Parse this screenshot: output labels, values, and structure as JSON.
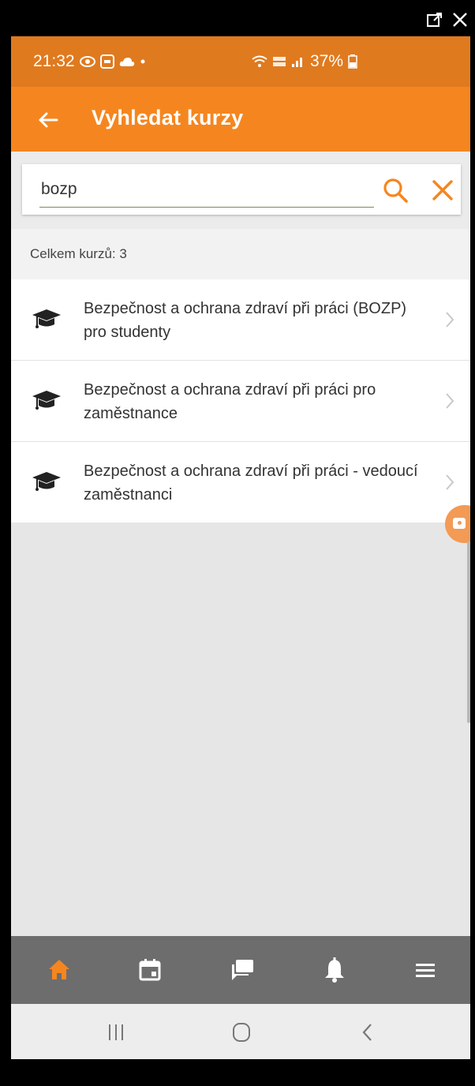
{
  "status": {
    "time": "21:32",
    "battery": "37%"
  },
  "appbar": {
    "title": "Vyhledat kurzy"
  },
  "search": {
    "value": "bozp"
  },
  "results": {
    "count_label": "Celkem kurzů: 3",
    "items": [
      {
        "title": "Bezpečnost a ochrana zdraví při práci (BOZP) pro studenty"
      },
      {
        "title": "Bezpečnost a ochrana zdraví při práci pro zaměstnance"
      },
      {
        "title": "Bezpečnost a ochrana zdraví při práci - vedoucí zaměstnanci"
      }
    ]
  },
  "icons": {
    "back": "arrow-left-icon",
    "search": "magnifier-icon",
    "clear": "close-icon",
    "course": "graduation-cap-icon",
    "nav": [
      "home-icon",
      "calendar-icon",
      "chat-icon",
      "bell-icon",
      "menu-icon"
    ]
  },
  "colors": {
    "accent": "#f5861f",
    "statusbar": "#e07a1f",
    "bottomnav": "#6d6d6d"
  }
}
